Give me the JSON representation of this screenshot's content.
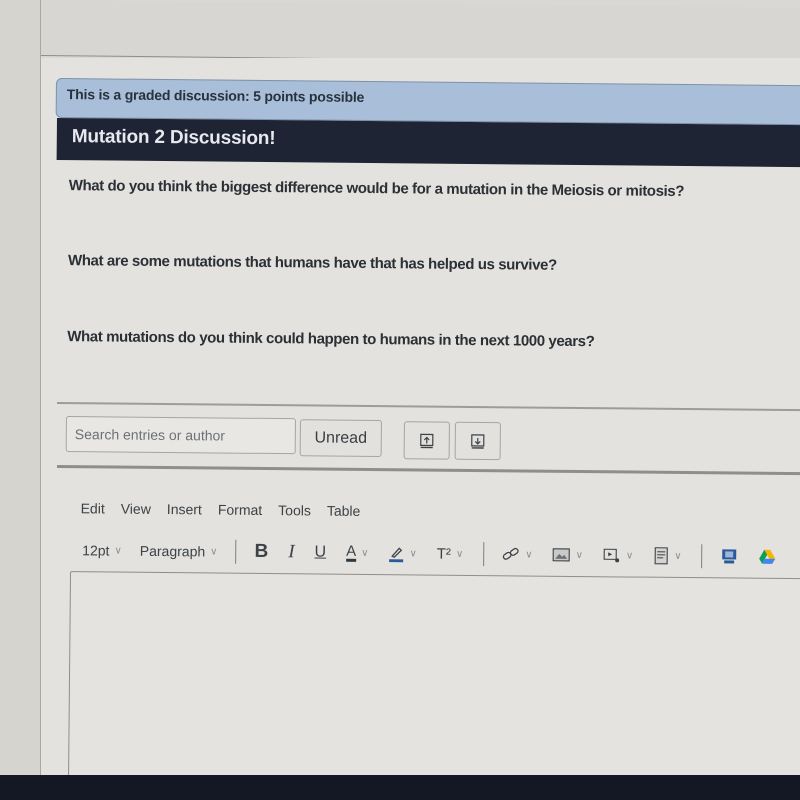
{
  "banner": {
    "text": "This is a graded discussion: 5 points possible"
  },
  "discussion": {
    "title": "Mutation 2 Discussion!",
    "questions": [
      "What do you think the biggest difference would be for a mutation in the Meiosis or mitosis?",
      "What are some mutations that humans have that has helped us survive?",
      "What mutations do you think could happen to humans in the next 1000 years?"
    ]
  },
  "filter_bar": {
    "search_placeholder": "Search entries or author",
    "search_value": "",
    "unread_label": "Unread",
    "icons": [
      "collapse-threads-icon",
      "expand-threads-icon"
    ]
  },
  "editor": {
    "menu": [
      "Edit",
      "View",
      "Insert",
      "Format",
      "Tools",
      "Table"
    ],
    "font_size": "12pt",
    "block_format": "Paragraph",
    "format_buttons": {
      "bold": "B",
      "italic": "I",
      "underline": "U",
      "text_color": "A",
      "superscript": "T²"
    },
    "insert_icons": [
      "link-icon",
      "image-icon",
      "media-icon",
      "document-icon",
      "apps-icon",
      "google-drive-icon"
    ],
    "content": ""
  },
  "colors": {
    "banner_bg": "#a9bfd9",
    "title_bg": "#1e2433",
    "accent_blue": "#2b5a9c"
  }
}
